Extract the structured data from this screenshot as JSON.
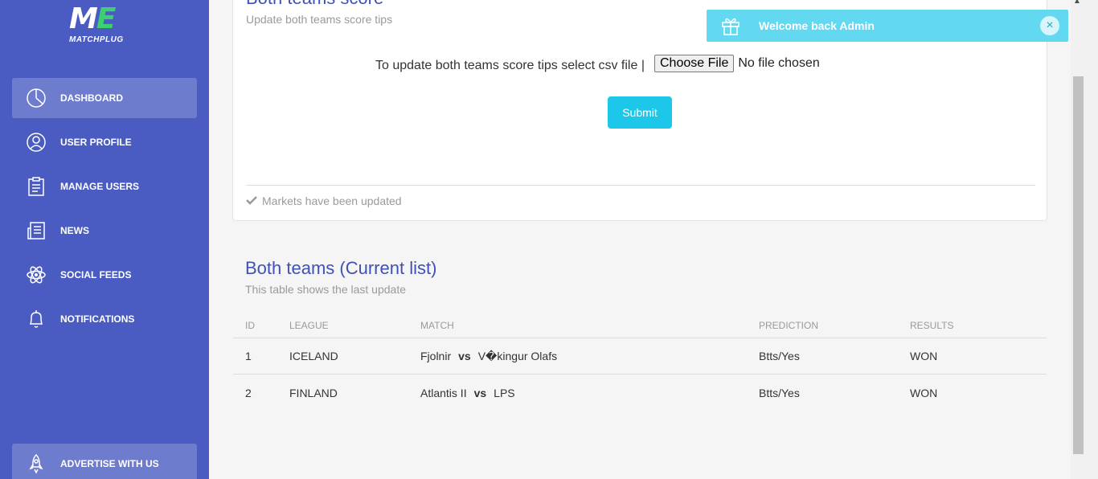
{
  "brand": {
    "logo_text": "ME",
    "name": "MATCHPLUG"
  },
  "sidebar": {
    "items": [
      {
        "label": "DASHBOARD",
        "icon": "chart-pie-icon",
        "active": true
      },
      {
        "label": "USER PROFILE",
        "icon": "user-circle-icon",
        "active": false
      },
      {
        "label": "MANAGE USERS",
        "icon": "clipboard-icon",
        "active": false
      },
      {
        "label": "NEWS",
        "icon": "newspaper-icon",
        "active": false
      },
      {
        "label": "SOCIAL FEEDS",
        "icon": "atom-icon",
        "active": false
      },
      {
        "label": "NOTIFICATIONS",
        "icon": "bell-icon",
        "active": false
      }
    ],
    "advertise": {
      "label": "ADVERTISE WITH US",
      "icon": "rocket-icon"
    }
  },
  "upload_card": {
    "title": "Both teams score",
    "subtitle": "Update both teams score tips",
    "upload_label": "To update both teams score tips select csv file |",
    "file_button": "Choose File",
    "file_state": "No file chosen",
    "submit_label": "Submit",
    "footer_text": "Markets have been updated"
  },
  "list": {
    "title": "Both teams (Current list)",
    "subtitle": "This table shows the last update",
    "columns": [
      "ID",
      "LEAGUE",
      "MATCH",
      "PREDICTION",
      "RESULTS"
    ],
    "rows": [
      {
        "id": "1",
        "league": "ICELAND",
        "home": "Fjolnir",
        "vs": "vs",
        "away": "V�kingur Olafs",
        "prediction": "Btts/Yes",
        "result": "WON"
      },
      {
        "id": "2",
        "league": "FINLAND",
        "home": "Atlantis II",
        "vs": "vs",
        "away": "LPS",
        "prediction": "Btts/Yes",
        "result": "WON"
      }
    ]
  },
  "toast": {
    "prefix": "Welcome back ",
    "user": "Admin",
    "close": "×"
  },
  "colors": {
    "sidebar": "#4a5cc2",
    "accent": "#3f51b5",
    "button": "#1dc7ea",
    "toast": "#63d8f1"
  }
}
